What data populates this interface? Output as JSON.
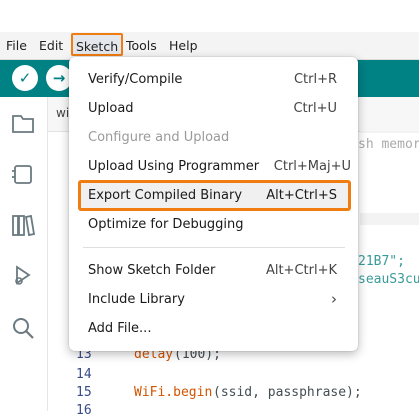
{
  "menubar": {
    "items": [
      "File",
      "Edit",
      "Sketch",
      "Tools",
      "Help"
    ]
  },
  "sketch_menu": {
    "items": [
      {
        "label": "Verify/Compile",
        "shortcut": "Ctrl+R"
      },
      {
        "label": "Upload",
        "shortcut": "Ctrl+U"
      },
      {
        "label": "Configure and Upload",
        "shortcut": ""
      },
      {
        "label": "Upload Using Programmer",
        "shortcut": "Ctrl+Maj+U"
      },
      {
        "label": "Export Compiled Binary",
        "shortcut": "Alt+Ctrl+S"
      },
      {
        "label": "Optimize for Debugging",
        "shortcut": ""
      },
      {
        "label": "Show Sketch Folder",
        "shortcut": "Alt+Ctrl+K"
      },
      {
        "label": "Include Library",
        "shortcut": "›"
      },
      {
        "label": "Add File...",
        "shortcut": ""
      }
    ]
  },
  "editor": {
    "tab_fragment": "wi",
    "peek_fragments": {
      "comment": "sh memor",
      "string1": "21B7\";",
      "string2": "seauS3cu"
    },
    "lines": [
      {
        "num": "13",
        "func": "delay",
        "rest": "(100);"
      },
      {
        "num": "14",
        "func": "",
        "rest": ""
      },
      {
        "num": "15",
        "func": "WiFi.begin",
        "rest": "(ssid, passphrase);"
      },
      {
        "num": "16",
        "func": "",
        "rest": ""
      }
    ]
  },
  "icons": {
    "toolbar": [
      "verify-icon",
      "upload-icon"
    ],
    "sidebar": [
      "folder-icon",
      "board-icon",
      "library-icon",
      "debug-icon",
      "search-icon"
    ]
  },
  "colors": {
    "toolbar": "#008184",
    "highlight": "#ef7d12"
  }
}
